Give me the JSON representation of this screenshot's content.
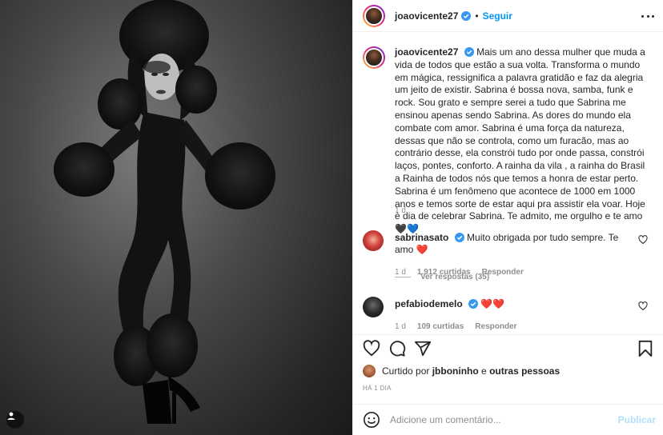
{
  "post": {
    "author": "joaovicente27",
    "follow_label": "Seguir",
    "separator": "•",
    "caption": "Mais um ano dessa mulher que muda a vida de todos que estão a sua volta. Transforma o mundo em mágica, ressignifica a palavra gratidão e faz da alegria um jeito de existir. Sabrina é bossa nova, samba, funk e rock. Sou grato e sempre serei a tudo que Sabrina me ensinou apenas sendo Sabrina. As dores do mundo ela combate com amor. Sabrina é uma força da natureza, dessas que não se controla, como um furacão, mas ao contrário desse, ela constrói tudo por onde passa, constrói laços, pontes, conforto. A rainha da vila , a rainha do Brasil a Rainha de todos nós que temos a honra de estar perto. Sabrina é um fenômeno que acontece de 1000 em 1000 anos e temos sorte de estar aqui pra assistir ela voar. Hoje é dia de celebrar Sabrina. Te admito, me orgulho e te amo 🖤💙",
    "caption_time": "1 d"
  },
  "comments": [
    {
      "username": "sabrinasato",
      "text": "Muito obrigada por tudo sempre. Te amo ❤️",
      "time": "1 d",
      "likes": "1.912 curtidas",
      "reply": "Responder",
      "view_replies": "Ver respostas (35)"
    },
    {
      "username": "pefabiodemelo",
      "text": "❤️❤️",
      "time": "1 d",
      "likes": "109 curtidas",
      "reply": "Responder"
    }
  ],
  "liked_by": {
    "prefix": "Curtido por",
    "user": "jbboninho",
    "conjunction": "e",
    "others": "outras pessoas"
  },
  "posted_ago": "HÁ 1 DIA",
  "comment_box": {
    "placeholder": "Adicione um comentário...",
    "publish": "Publicar"
  },
  "colors": {
    "accent": "#0095f6",
    "verified": "#3897f0",
    "heart": "#ed4956",
    "muted": "#8e8e8e"
  },
  "icons": [
    "verified-badge-icon",
    "more-options-icon",
    "heart-icon",
    "comment-icon",
    "share-icon",
    "bookmark-icon",
    "emoji-icon",
    "tag-user-icon"
  ]
}
